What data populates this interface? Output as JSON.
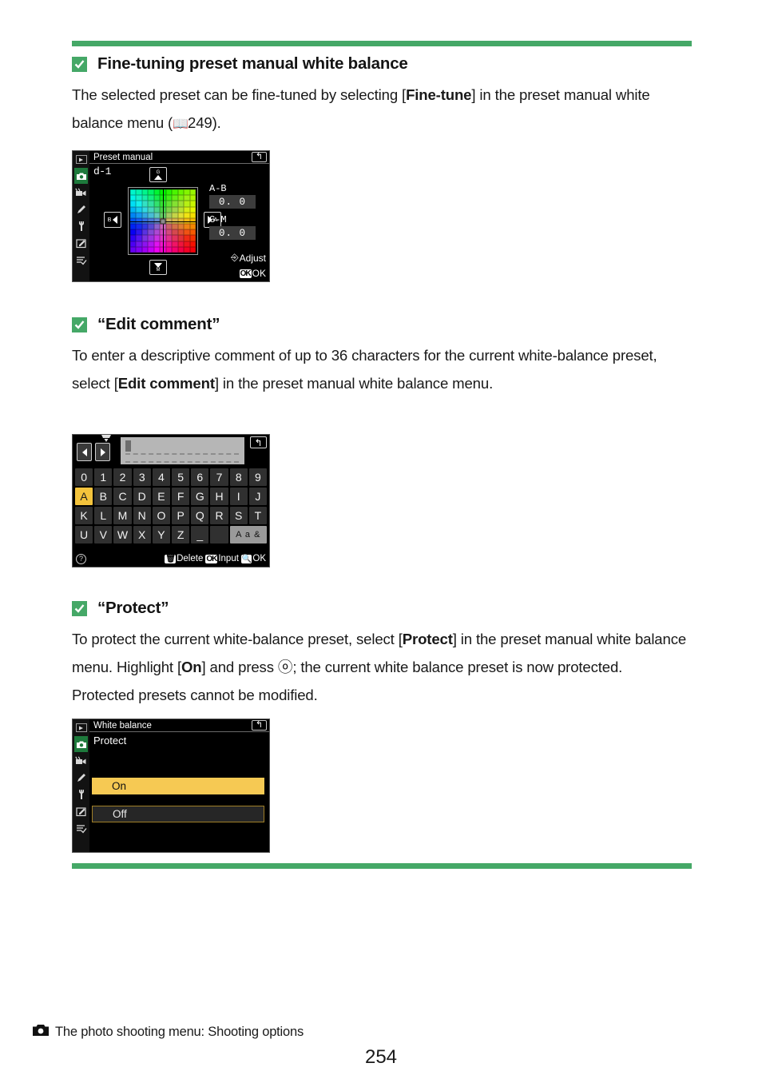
{
  "page": {
    "number": "254",
    "footer_text": "The photo shooting menu: Shooting options",
    "footer_icon": "camera-icon"
  },
  "sections": [
    {
      "icon": "green-check-icon",
      "heading": "Fine-tuning preset manual white balance",
      "body_part1": "The selected preset can be fine-tuned by selecting [",
      "body_bold1": "Fine-tune",
      "body_part2": "] in the preset manual white balance menu (",
      "body_ref": "249",
      "body_part3": ")."
    },
    {
      "icon": "green-check-icon",
      "heading": "“Edit comment”",
      "body_part1": "To enter a descriptive comment of up to 36 characters for the current white-balance preset, select [",
      "body_bold1": "Edit comment",
      "body_part2": "] in the preset manual white balance menu."
    },
    {
      "icon": "green-check-icon",
      "heading": "“Protect”",
      "body_part1": "To protect the current white-balance preset, select [",
      "body_bold1": "Protect",
      "body_part2": "] in the preset manual white balance menu. Highlight [",
      "body_bold2": "On",
      "body_part3": "] and press ⓞ; the current white balance preset is now protected. Protected presets cannot be modified."
    }
  ],
  "screenshot_finetune": {
    "title": "Preset manual",
    "return_icon": "return-arrow-icon",
    "preset_label": "d-1",
    "btn_g_label": "G",
    "btn_m_label": "M",
    "btn_b_label": "B",
    "btn_a_label": "A",
    "ab_label": "A-B",
    "ab_value": "0. 0",
    "gm_label": "G-M",
    "gm_value": "0. 0",
    "adjust_hint": "Adjust",
    "ok_key": "OK",
    "ok_hint": "OK",
    "sidebar_icons": [
      "playback-icon",
      "photo-shooting-menu-icon",
      "movie-shooting-menu-icon",
      "custom-settings-icon",
      "setup-menu-icon",
      "retouch-menu-icon",
      "my-menu-icon"
    ]
  },
  "screenshot_keyboard": {
    "return_icon": "return-arrow-icon",
    "keyboard_select_icon": "keyboard-select-icon",
    "prev_icon": "left-arrow-icon",
    "next_icon": "right-arrow-icon",
    "text_value": "",
    "rows": [
      [
        "0",
        "1",
        "2",
        "3",
        "4",
        "5",
        "6",
        "7",
        "8",
        "9"
      ],
      [
        "A",
        "B",
        "C",
        "D",
        "E",
        "F",
        "G",
        "H",
        "I",
        "J"
      ],
      [
        "K",
        "L",
        "M",
        "N",
        "O",
        "P",
        "Q",
        "R",
        "S",
        "T"
      ],
      [
        "U",
        "V",
        "W",
        "X",
        "Y",
        "Z",
        "_"
      ]
    ],
    "selected_key": "A",
    "shift_key": "A a &",
    "help_icon": "question-mark-icon",
    "delete_icon": "trash-icon",
    "delete_label": "Delete",
    "input_key": "OK",
    "input_label": "Input",
    "zoom_icon": "magnifier-icon",
    "ok_label": "OK"
  },
  "screenshot_protect": {
    "title": "White balance",
    "return_icon": "return-arrow-icon",
    "subtitle": "Protect",
    "options": [
      {
        "label": "On",
        "state": "highlighted"
      },
      {
        "label": "Off",
        "state": "normal"
      }
    ],
    "sidebar_icons": [
      "playback-icon",
      "photo-shooting-menu-icon",
      "movie-shooting-menu-icon",
      "custom-settings-icon",
      "setup-menu-icon",
      "retouch-menu-icon",
      "my-menu-icon"
    ]
  },
  "colors": {
    "accent_green": "#45a867",
    "highlight_yellow": "#f6c953",
    "key_selected": "#f3c33c",
    "screen_black": "#000000"
  }
}
